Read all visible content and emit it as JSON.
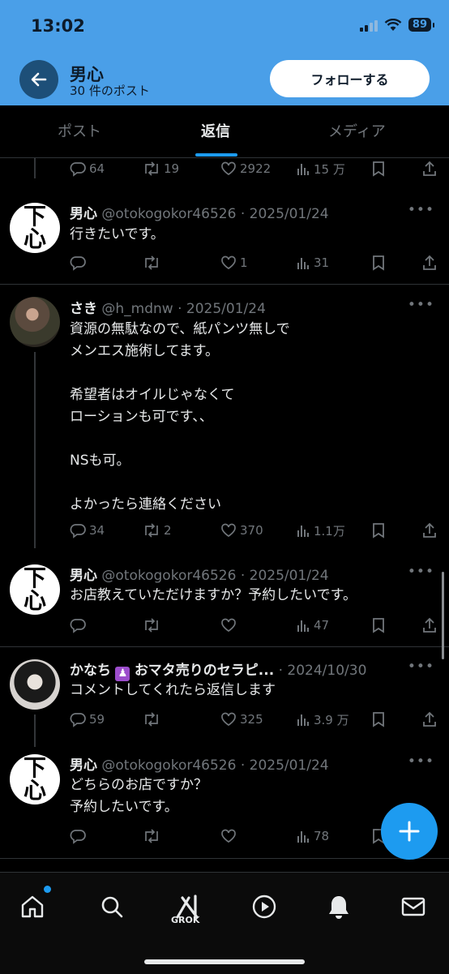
{
  "status": {
    "time": "13:02",
    "battery": "89"
  },
  "header": {
    "name": "男心",
    "post_count": "30 件のポスト",
    "follow_label": "フォローする"
  },
  "tabs": [
    {
      "label": "ポスト"
    },
    {
      "label": "返信"
    },
    {
      "label": "メディア"
    }
  ],
  "posts": [
    {
      "replies": "64",
      "reposts": "19",
      "likes": "2922",
      "views": "15 万"
    },
    {
      "name": "男心",
      "meta": "@otokogokor46526 · 2025/01/24",
      "avatar_text": [
        "下",
        "心"
      ],
      "body": "行きたいです。",
      "replies": "",
      "reposts": "",
      "likes": "1",
      "views": "31"
    },
    {
      "name": "さき",
      "meta": "@h_mdnw · 2025/01/24",
      "body": "資源の無駄なので、紙パンツ無しで\nメンエス施術してます。\n\n希望者はオイルじゃなくて\nローションも可です、、\n\nNSも可。\n\nよかったら連絡ください",
      "replies": "34",
      "reposts": "2",
      "likes": "370",
      "views": "1.1万"
    },
    {
      "name": "男心",
      "meta": "@otokogokor46526 · 2025/01/24",
      "avatar_text": [
        "下",
        "心"
      ],
      "body": "お店教えていただけますか？予約したいです。",
      "replies": "",
      "reposts": "",
      "likes": "",
      "views": "47"
    },
    {
      "name": "かなち",
      "name_rest": "おマタ売りのセラピ...",
      "meta": " · 2024/10/30",
      "body": "コメントしてくれたら返信します",
      "replies": "59",
      "reposts": "",
      "likes": "325",
      "views": "3.9 万"
    },
    {
      "name": "男心",
      "meta": "@otokogokor46526 · 2025/01/24",
      "avatar_text": [
        "下",
        "心"
      ],
      "body": "どちらのお店ですか？\n予約したいです。",
      "replies": "",
      "reposts": "",
      "likes": "",
      "views": "78"
    }
  ],
  "more_glyph": "•••",
  "bottom_nav": {
    "grok_label": "GROK"
  },
  "colors": {
    "header_blue": "#4a9fe8",
    "accent": "#1d9bf0",
    "background": "#000000"
  }
}
